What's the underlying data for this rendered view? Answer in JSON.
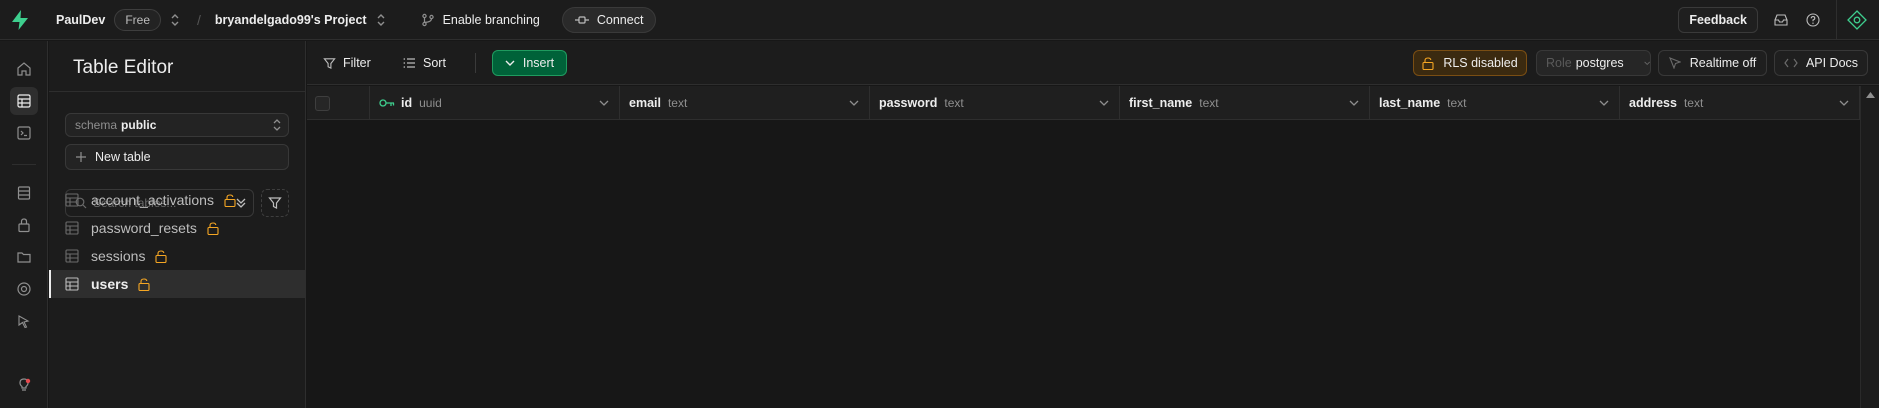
{
  "topbar": {
    "org_name": "PaulDev",
    "plan_badge": "Free",
    "project_name": "bryandelgado99's Project",
    "branching_label": "Enable branching",
    "connect_label": "Connect",
    "feedback_label": "Feedback",
    "logo_color": "#3ecf8e"
  },
  "sidebar": {
    "title": "Table Editor",
    "schema_label": "schema",
    "schema_value": "public",
    "new_table_label": "New table",
    "search_placeholder": "Search tables...",
    "tables": [
      {
        "name": "account_activations",
        "active": false
      },
      {
        "name": "password_resets",
        "active": false
      },
      {
        "name": "sessions",
        "active": false
      },
      {
        "name": "users",
        "active": true
      }
    ]
  },
  "toolbar": {
    "filter_label": "Filter",
    "sort_label": "Sort",
    "insert_label": "Insert",
    "rls_label": "RLS disabled",
    "role_key": "Role",
    "role_value": "postgres",
    "realtime_label": "Realtime off",
    "api_docs_label": "API Docs"
  },
  "grid": {
    "columns": [
      {
        "name": "id",
        "type": "uuid",
        "primary_key": true
      },
      {
        "name": "email",
        "type": "text"
      },
      {
        "name": "password",
        "type": "text"
      },
      {
        "name": "first_name",
        "type": "text"
      },
      {
        "name": "last_name",
        "type": "text"
      },
      {
        "name": "address",
        "type": "text"
      }
    ],
    "rows": []
  },
  "colors": {
    "accent_green": "#3ecf8e",
    "insert_bg": "#006239",
    "warning": "#f5a623",
    "notification_dot": "#e5484d"
  }
}
